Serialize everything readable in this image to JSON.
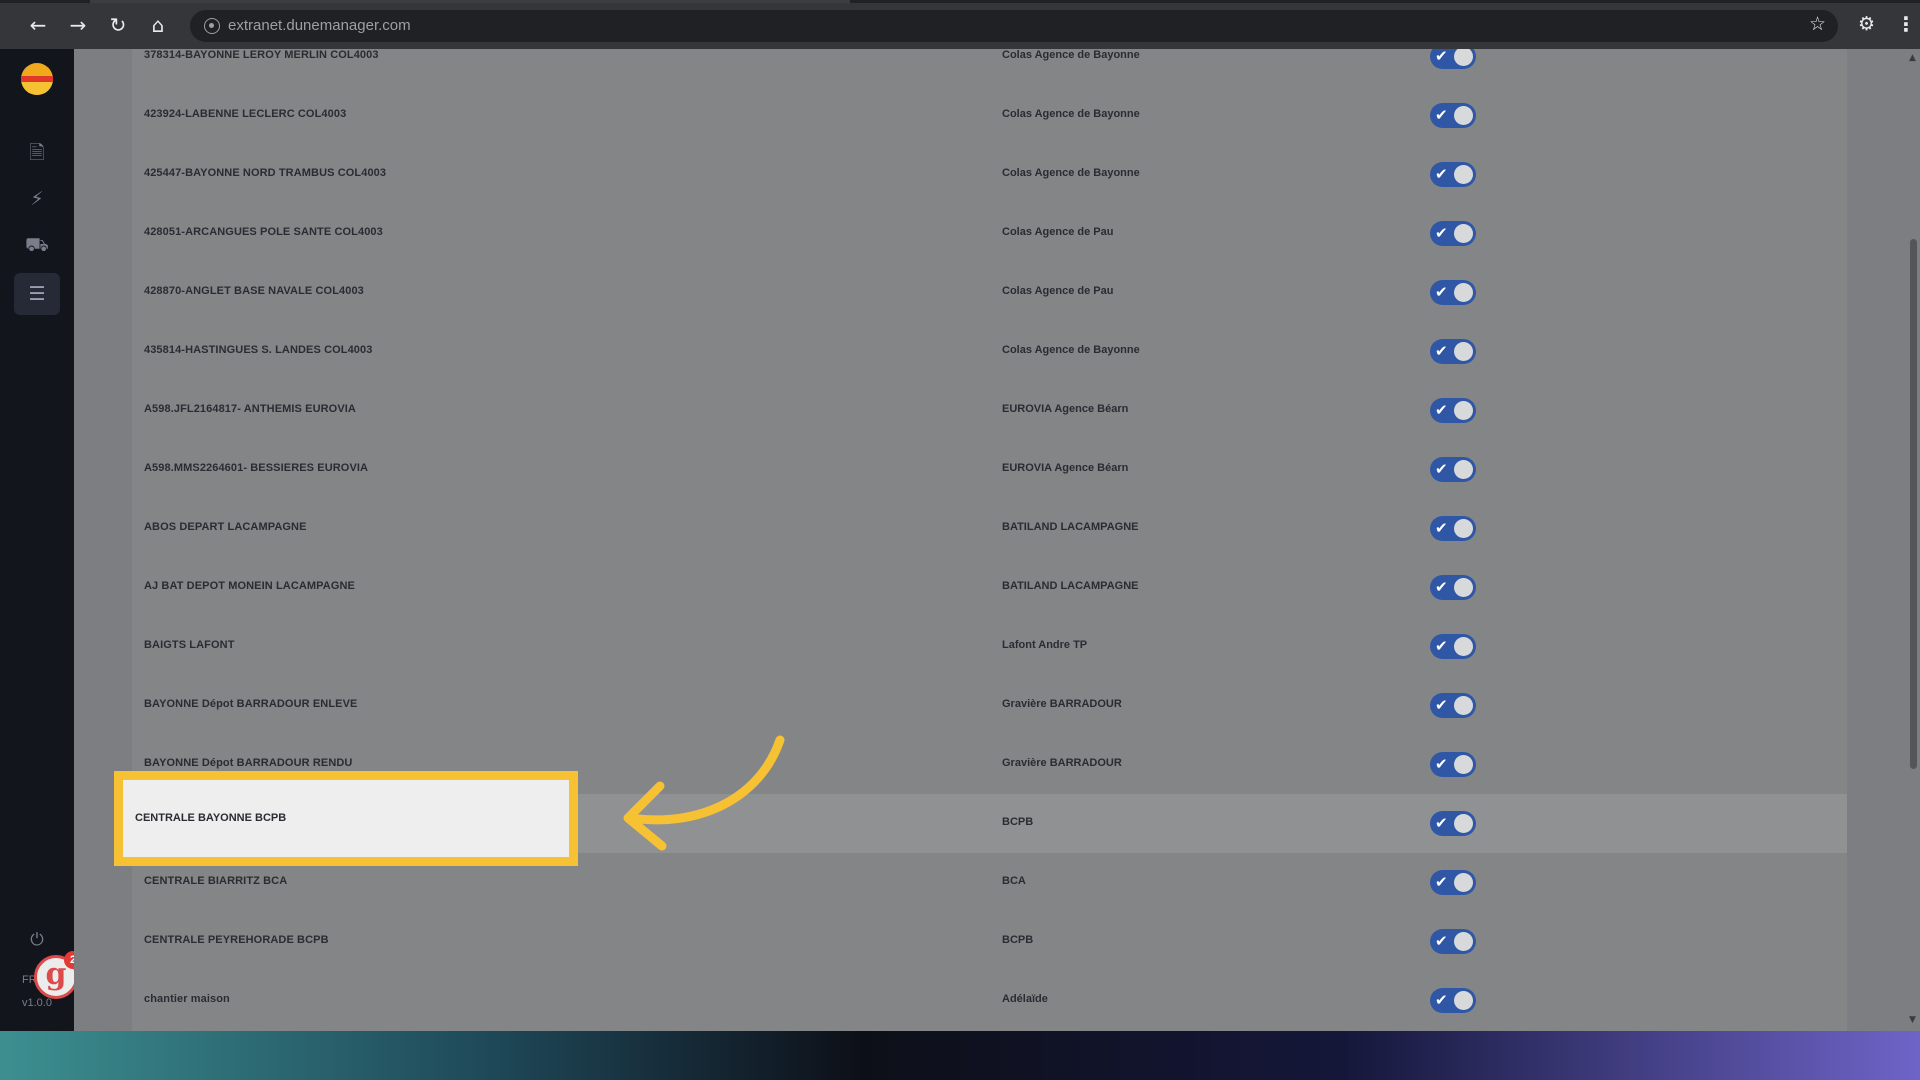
{
  "browser": {
    "url": "extranet.dunemanager.com"
  },
  "sidebar": {
    "language": "FR",
    "version": "v1.0.0",
    "badge_count": "2",
    "avatar_letter": "g"
  },
  "rows": [
    {
      "name": "378314-BAYONNE LEROY MERLIN COL4003",
      "agency": "Colas Agence de Bayonne"
    },
    {
      "name": "423924-LABENNE LECLERC COL4003",
      "agency": "Colas Agence de Bayonne"
    },
    {
      "name": "425447-BAYONNE NORD TRAMBUS COL4003",
      "agency": "Colas Agence de Bayonne"
    },
    {
      "name": "428051-ARCANGUES POLE SANTE COL4003",
      "agency": "Colas Agence de Pau"
    },
    {
      "name": "428870-ANGLET BASE NAVALE COL4003",
      "agency": "Colas Agence de Pau"
    },
    {
      "name": "435814-HASTINGUES S. LANDES COL4003",
      "agency": "Colas Agence de Bayonne"
    },
    {
      "name": "A598.JFL2164817- ANTHEMIS EUROVIA",
      "agency": "EUROVIA Agence Béarn"
    },
    {
      "name": "A598.MMS2264601- BESSIERES EUROVIA",
      "agency": "EUROVIA Agence Béarn"
    },
    {
      "name": "ABOS DEPART LACAMPAGNE",
      "agency": "BATILAND LACAMPAGNE"
    },
    {
      "name": "AJ BAT DEPOT MONEIN LACAMPAGNE",
      "agency": "BATILAND LACAMPAGNE"
    },
    {
      "name": "BAIGTS LAFONT",
      "agency": "Lafont Andre TP"
    },
    {
      "name": "BAYONNE Dépot BARRADOUR ENLEVE",
      "agency": "Gravière BARRADOUR"
    },
    {
      "name": "BAYONNE Dépot BARRADOUR RENDU",
      "agency": "Gravière BARRADOUR"
    },
    {
      "name": "CENTRALE BAYONNE BCPB",
      "agency": "BCPB"
    },
    {
      "name": "CENTRALE BIARRITZ BCA",
      "agency": "BCA"
    },
    {
      "name": "CENTRALE PEYREHORADE BCPB",
      "agency": "BCPB"
    },
    {
      "name": "chantier maison",
      "agency": "Adélaïde"
    }
  ],
  "highlight": {
    "label": "CENTRALE BAYONNE BCPB"
  },
  "colors": {
    "toggle_on": "#2f57a6",
    "highlight_border": "#f6c233",
    "arrow": "#f6c233"
  }
}
